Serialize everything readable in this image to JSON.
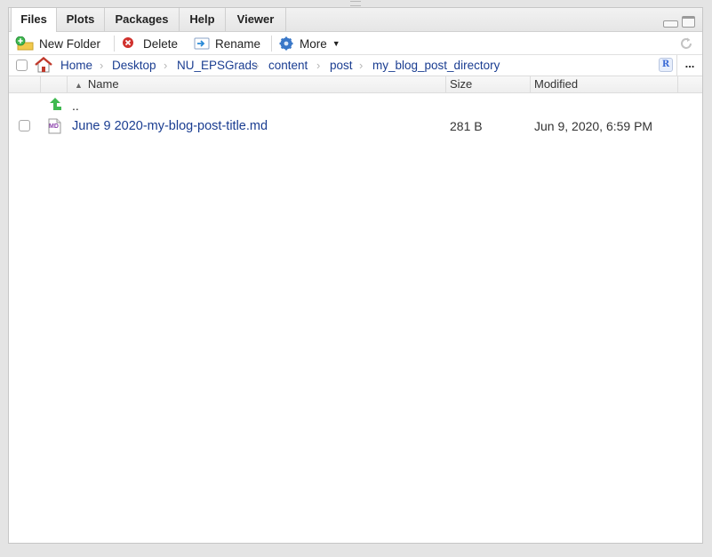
{
  "tabs": [
    {
      "label": "Files",
      "active": true
    },
    {
      "label": "Plots",
      "active": false
    },
    {
      "label": "Packages",
      "active": false
    },
    {
      "label": "Help",
      "active": false
    },
    {
      "label": "Viewer",
      "active": false
    }
  ],
  "toolbar": {
    "new_folder": "New Folder",
    "delete": "Delete",
    "rename": "Rename",
    "more": "More"
  },
  "breadcrumb": [
    "Home",
    "Desktop",
    "NU_EPSGrads",
    "content",
    "post",
    "my_blog_post_directory"
  ],
  "breadcrumb_more": "...",
  "table": {
    "headers": {
      "name": "Name",
      "size": "Size",
      "modified": "Modified"
    },
    "parent_label": "..",
    "rows": [
      {
        "icon": "MD",
        "name": "June 9 2020-my-blog-post-title.md",
        "size": "281 B",
        "modified": "Jun 9, 2020, 6:59 PM"
      }
    ]
  },
  "colors": {
    "link": "#1a3d91",
    "accent_green": "#3fb950",
    "delete_red": "#d0312d",
    "gear_blue": "#3a78c8"
  }
}
